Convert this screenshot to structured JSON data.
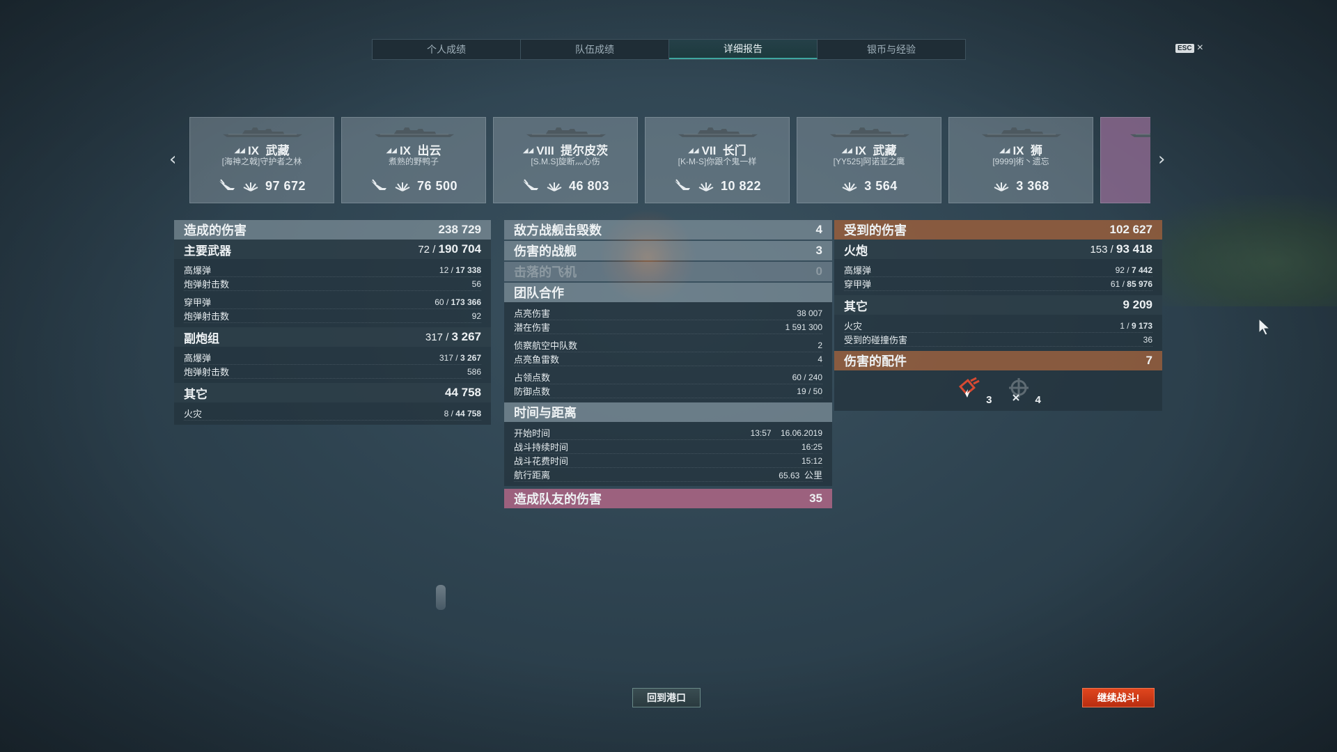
{
  "tabs": [
    "个人成绩",
    "队伍成绩",
    "详细报告",
    "银币与经验"
  ],
  "active_tab": 2,
  "esc": {
    "key": "ESC",
    "close": "×"
  },
  "ships": [
    {
      "tier": "IX",
      "name": "武藏",
      "player": "[海神之戟]守护者之林",
      "show_plane": true,
      "damage": "97 672"
    },
    {
      "tier": "IX",
      "name": "出云",
      "player": "煮熟的野鸭子",
      "show_plane": true,
      "damage": "76 500"
    },
    {
      "tier": "VIII",
      "name": "提尔皮茨",
      "player": "[S.M.S]旋断灬心伤",
      "show_plane": true,
      "damage": "46 803"
    },
    {
      "tier": "VII",
      "name": "长门",
      "player": "[K-M-S]你跟个鬼一样",
      "show_plane": true,
      "damage": "10 822"
    },
    {
      "tier": "IX",
      "name": "武藏",
      "player": "[YY525]阿诺亚之鹰",
      "show_plane": false,
      "damage": "3 564"
    },
    {
      "tier": "IX",
      "name": "狮",
      "player": "[9999]術丶遗忘",
      "show_plane": false,
      "damage": "3 368"
    }
  ],
  "left": {
    "damage_dealt": {
      "label": "造成的伤害",
      "value": "238 729"
    },
    "main_battery": {
      "label": "主要武器",
      "hits": "72",
      "value": "190 704"
    },
    "mb_he": {
      "label": "高爆弹",
      "hits": "12",
      "value": "17 338"
    },
    "mb_he_shots": {
      "label": "炮弹射击数",
      "value": "56"
    },
    "mb_ap": {
      "label": "穿甲弹",
      "hits": "60",
      "value": "173 366"
    },
    "mb_ap_shots": {
      "label": "炮弹射击数",
      "value": "92"
    },
    "secondary": {
      "label": "副炮组",
      "hits": "317",
      "value": "3 267"
    },
    "sec_he": {
      "label": "高爆弹",
      "hits": "317",
      "value": "3 267"
    },
    "sec_he_shots": {
      "label": "炮弹射击数",
      "value": "586"
    },
    "other": {
      "label": "其它",
      "value": "44 758"
    },
    "fire": {
      "label": "火灾",
      "hits": "8",
      "value": "44 758"
    }
  },
  "mid": {
    "ships_destroyed": {
      "label": "敌方战舰击毁数",
      "value": "4"
    },
    "ships_damaged": {
      "label": "伤害的战舰",
      "value": "3"
    },
    "planes_shot": {
      "label": "击落的飞机",
      "value": "0"
    },
    "teamwork": {
      "label": "团队合作"
    },
    "spotting_damage": {
      "label": "点亮伤害",
      "value": "38 007"
    },
    "potential_damage": {
      "label": "潜在伤害",
      "value": "1 591 300"
    },
    "spotted_squadrons": {
      "label": "侦察航空中队数",
      "value": "2"
    },
    "spotted_torpedoes": {
      "label": "点亮鱼雷数",
      "value": "4"
    },
    "capture_points": {
      "label": "占领点数",
      "value": "60 / 240"
    },
    "defense_points": {
      "label": "防御点数",
      "value": "19 / 50"
    },
    "time_distance": {
      "label": "时间与距离"
    },
    "start_time": {
      "label": "开始时间",
      "time": "13:57",
      "date": "16.06.2019"
    },
    "battle_duration": {
      "label": "战斗持续时间",
      "value": "16:25"
    },
    "time_spent": {
      "label": "战斗花费时间",
      "value": "15:12"
    },
    "distance": {
      "label": "航行距离",
      "value": "65.63",
      "unit": "公里"
    },
    "team_damage": {
      "label": "造成队友的伤害",
      "value": "35"
    }
  },
  "right": {
    "damage_received": {
      "label": "受到的伤害",
      "value": "102 627"
    },
    "artillery": {
      "label": "火炮",
      "hits": "153",
      "value": "93 418"
    },
    "art_he": {
      "label": "高爆弹",
      "hits": "92",
      "value": "7 442"
    },
    "art_ap": {
      "label": "穿甲弹",
      "hits": "61",
      "value": "85 976"
    },
    "other": {
      "label": "其它",
      "value": "9 209"
    },
    "fire": {
      "label": "火灾",
      "hits": "1",
      "value": "9 173"
    },
    "ramming": {
      "label": "受到的碰撞伤害",
      "value": "36"
    },
    "damaged_modules": {
      "label": "伤害的配件",
      "value": "7"
    },
    "modules": [
      {
        "icon": "engine-damage-icon",
        "count": "3"
      },
      {
        "icon": "steering-damage-icon",
        "count": "4"
      }
    ]
  },
  "buttons": {
    "to_port": "回到港口",
    "continue": "继续战斗!"
  },
  "colors": {
    "accent_teal": "#3fa7a0",
    "damage_received": "#985e3c",
    "team_damage": "#a56482",
    "battle_button": "#e0461e"
  }
}
